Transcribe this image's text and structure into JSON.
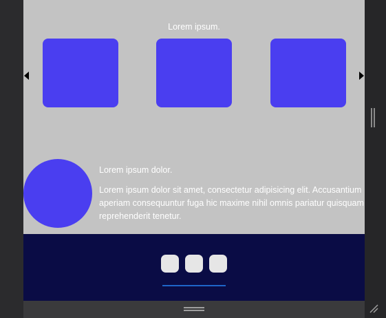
{
  "preview": {
    "caption": "Lorem ipsum.",
    "tile_color": "#4a3ef0",
    "tiles": [
      "tile-1",
      "tile-2",
      "tile-3"
    ],
    "nav": {
      "prev_icon": "triangle-left-icon",
      "next_icon": "triangle-right-icon"
    }
  },
  "profile": {
    "avatar_color": "#4a3ef0",
    "title": "Lorem ipsum dolor.",
    "text": "Lorem ipsum dolor sit amet, consectetur adipisicing elit. Accusantium aperiam consequuntur fuga hic maxime nihil omnis pariatur quisquam reprehenderit tenetur."
  },
  "footer": {
    "background": "#0a0c45",
    "dot_color": "#e6e6e6",
    "underline_color": "#1e66c9",
    "dots": [
      "dot-1",
      "dot-2",
      "dot-3"
    ]
  },
  "chrome": {
    "vertical_grip_icon": "vertical-resize-grip-icon",
    "horizontal_grip_icon": "horizontal-resize-grip-icon",
    "corner_icon": "corner-resize-icon"
  }
}
